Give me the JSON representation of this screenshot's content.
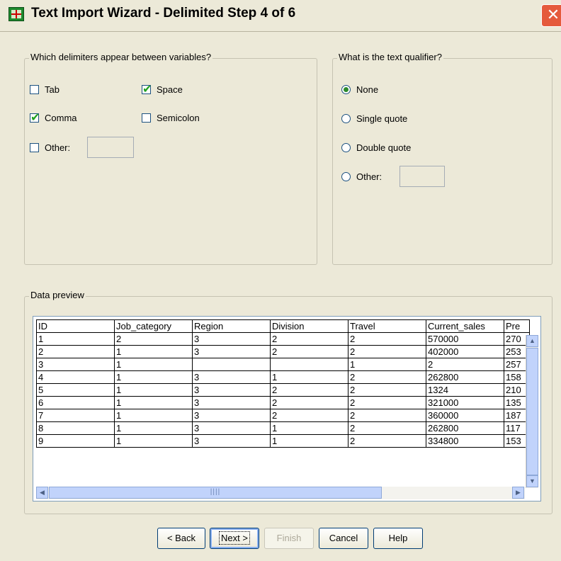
{
  "window": {
    "title": "Text Import Wizard - Delimited Step 4 of 6",
    "close_glyph": "✕"
  },
  "delimiters": {
    "legend": "Which delimiters appear between variables?",
    "tab": {
      "label": "Tab",
      "checked": false
    },
    "space": {
      "label": "Space",
      "checked": true
    },
    "comma": {
      "label": "Comma",
      "checked": true
    },
    "semicolon": {
      "label": "Semicolon",
      "checked": false
    },
    "other": {
      "label": "Other:",
      "checked": false,
      "value": ""
    }
  },
  "qualifier": {
    "legend": "What is the text qualifier?",
    "none": {
      "label": "None",
      "selected": true
    },
    "single": {
      "label": "Single quote",
      "selected": false
    },
    "double": {
      "label": "Double quote",
      "selected": false
    },
    "other": {
      "label": "Other:",
      "selected": false,
      "value": ""
    }
  },
  "preview": {
    "legend": "Data preview",
    "columns": [
      "ID",
      "Job_category",
      "Region",
      "Division",
      "Travel",
      "Current_sales",
      "Pre"
    ],
    "rows": [
      [
        "1",
        "2",
        "3",
        "2",
        "2",
        "570000",
        "270"
      ],
      [
        "2",
        "1",
        "3",
        "2",
        "2",
        "402000",
        "253"
      ],
      [
        "3",
        "1",
        "",
        "",
        "1",
        "2",
        "257"
      ],
      [
        "4",
        "1",
        "3",
        "1",
        "2",
        "262800",
        "158"
      ],
      [
        "5",
        "1",
        "3",
        "2",
        "2",
        "1324",
        "210"
      ],
      [
        "6",
        "1",
        "3",
        "2",
        "2",
        "321000",
        "135"
      ],
      [
        "7",
        "1",
        "3",
        "2",
        "2",
        "360000",
        "187"
      ],
      [
        "8",
        "1",
        "3",
        "1",
        "2",
        "262800",
        "117"
      ],
      [
        "9",
        "1",
        "3",
        "1",
        "2",
        "334800",
        "153"
      ]
    ]
  },
  "buttons": {
    "back": "< Back",
    "next": "Next >",
    "finish": "Finish",
    "cancel": "Cancel",
    "help": "Help"
  }
}
